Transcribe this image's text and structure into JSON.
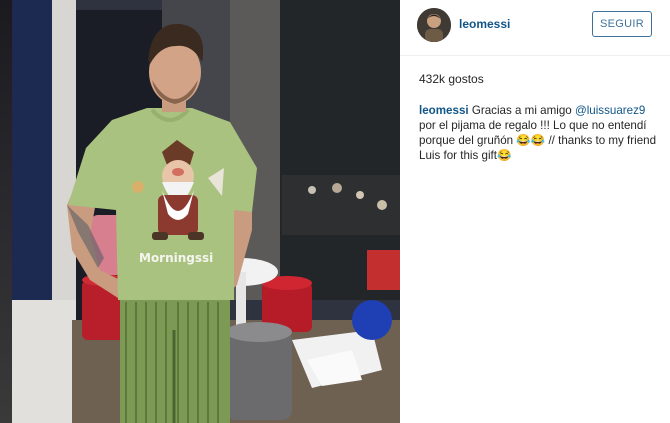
{
  "post": {
    "username": "leomessi",
    "follow_label": "SEGUIR",
    "likes": "432k gostos",
    "caption": {
      "user": "leomessi",
      "text_1": " Gracias a mi amigo ",
      "mention": "@luissuarez9",
      "text_2": " por el pijama de regalo !!! Lo que no entendí porque del gruñón ",
      "emoji_1": "😂😂",
      "text_3": " // thanks to my friend Luis for this gift",
      "emoji_2": "😂"
    }
  },
  "photo": {
    "shirt_text": "Morningssi",
    "shirt_color": "#a9c27f",
    "pants_color": "#7d9a55"
  },
  "colors": {
    "link": "#125688",
    "button_border": "#3f729b",
    "text": "#262626"
  }
}
